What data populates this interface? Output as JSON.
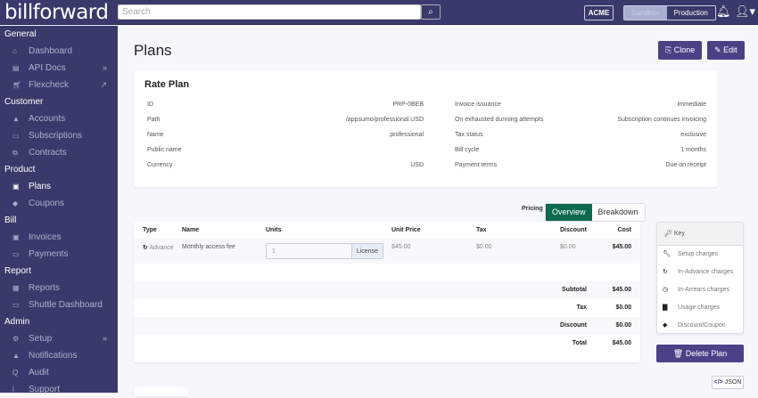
{
  "topbar": {
    "logo": "billforward",
    "search_placeholder": "Search",
    "org": "ACME",
    "env": [
      "Sandbox",
      "Production"
    ]
  },
  "sidebar": {
    "sections": [
      {
        "label": "General",
        "items": [
          {
            "label": "Dashboard",
            "icon": "home-icon"
          },
          {
            "label": "API Docs",
            "icon": "file-icon"
          },
          {
            "label": "Flexcheck",
            "icon": "cart-icon"
          }
        ]
      },
      {
        "label": "Customer",
        "items": [
          {
            "label": "Accounts",
            "icon": "user-icon"
          },
          {
            "label": "Subscriptions",
            "icon": "card-icon"
          },
          {
            "label": "Contracts",
            "icon": "contract-icon"
          }
        ]
      },
      {
        "label": "Product",
        "items": [
          {
            "label": "Plans",
            "icon": "briefcase-icon"
          },
          {
            "label": "Coupons",
            "icon": "tags-icon"
          }
        ]
      },
      {
        "label": "Bill",
        "items": [
          {
            "label": "Invoices",
            "icon": "money-icon"
          },
          {
            "label": "Payments",
            "icon": "credit-card-icon"
          }
        ]
      },
      {
        "label": "Report",
        "items": [
          {
            "label": "Reports",
            "icon": "table-icon"
          },
          {
            "label": "Shuttle Dashboard",
            "icon": "card-icon"
          }
        ]
      },
      {
        "label": "Admin",
        "items": [
          {
            "label": "Setup",
            "icon": "gear-icon"
          },
          {
            "label": "Notifications",
            "icon": "bell-icon"
          },
          {
            "label": "Audit",
            "icon": "search-icon"
          },
          {
            "label": "Support",
            "icon": "info-icon"
          }
        ]
      }
    ]
  },
  "page": {
    "title": "Plans",
    "clone": "Clone",
    "edit": "Edit"
  },
  "rate_plan": {
    "title": "Rate Plan",
    "left": [
      {
        "k": "ID",
        "v": "PRP-0BEB"
      },
      {
        "k": "Path",
        "v": "/appsumo/professional.USD"
      },
      {
        "k": "Name",
        "v": "professional"
      },
      {
        "k": "Public name",
        "v": ""
      },
      {
        "k": "Currency",
        "v": "USD"
      }
    ],
    "right": [
      {
        "k": "Invoice issuance",
        "v": "Immediate"
      },
      {
        "k": "On exhausted dunning attempts",
        "v": "Subscription continues invoicing"
      },
      {
        "k": "Tax status",
        "v": "exclusive"
      },
      {
        "k": "Bill cycle",
        "v": "1 months"
      },
      {
        "k": "Payment terms",
        "v": "Due on receipt"
      }
    ]
  },
  "pricing": {
    "label": "Pricing",
    "tabs": [
      "Overview",
      "Breakdown"
    ],
    "active": "Overview",
    "headers": [
      "Type",
      "Name",
      "Units",
      "Unit Price",
      "Tax",
      "Discount",
      "Cost"
    ],
    "row": {
      "type": "Advance",
      "name": "Monthly access fee",
      "units": "1",
      "unit_label": "License",
      "unit_price": "$45.00",
      "tax": "$0.00",
      "discount": "$0.00",
      "cost": "$45.00"
    },
    "totals": [
      {
        "k": "Subtotal",
        "v": "$45.00"
      },
      {
        "k": "Tax",
        "v": "$0.00"
      },
      {
        "k": "Discount",
        "v": "$0.00"
      },
      {
        "k": "Total",
        "v": "$45.00"
      }
    ]
  },
  "key": {
    "title": "Key",
    "items": [
      "Setup charges",
      "In-Advance charges",
      "In-Arrears charges",
      "Usage charges",
      "Discount/Coupon"
    ]
  },
  "delete": "Delete Plan",
  "json": "JSON"
}
